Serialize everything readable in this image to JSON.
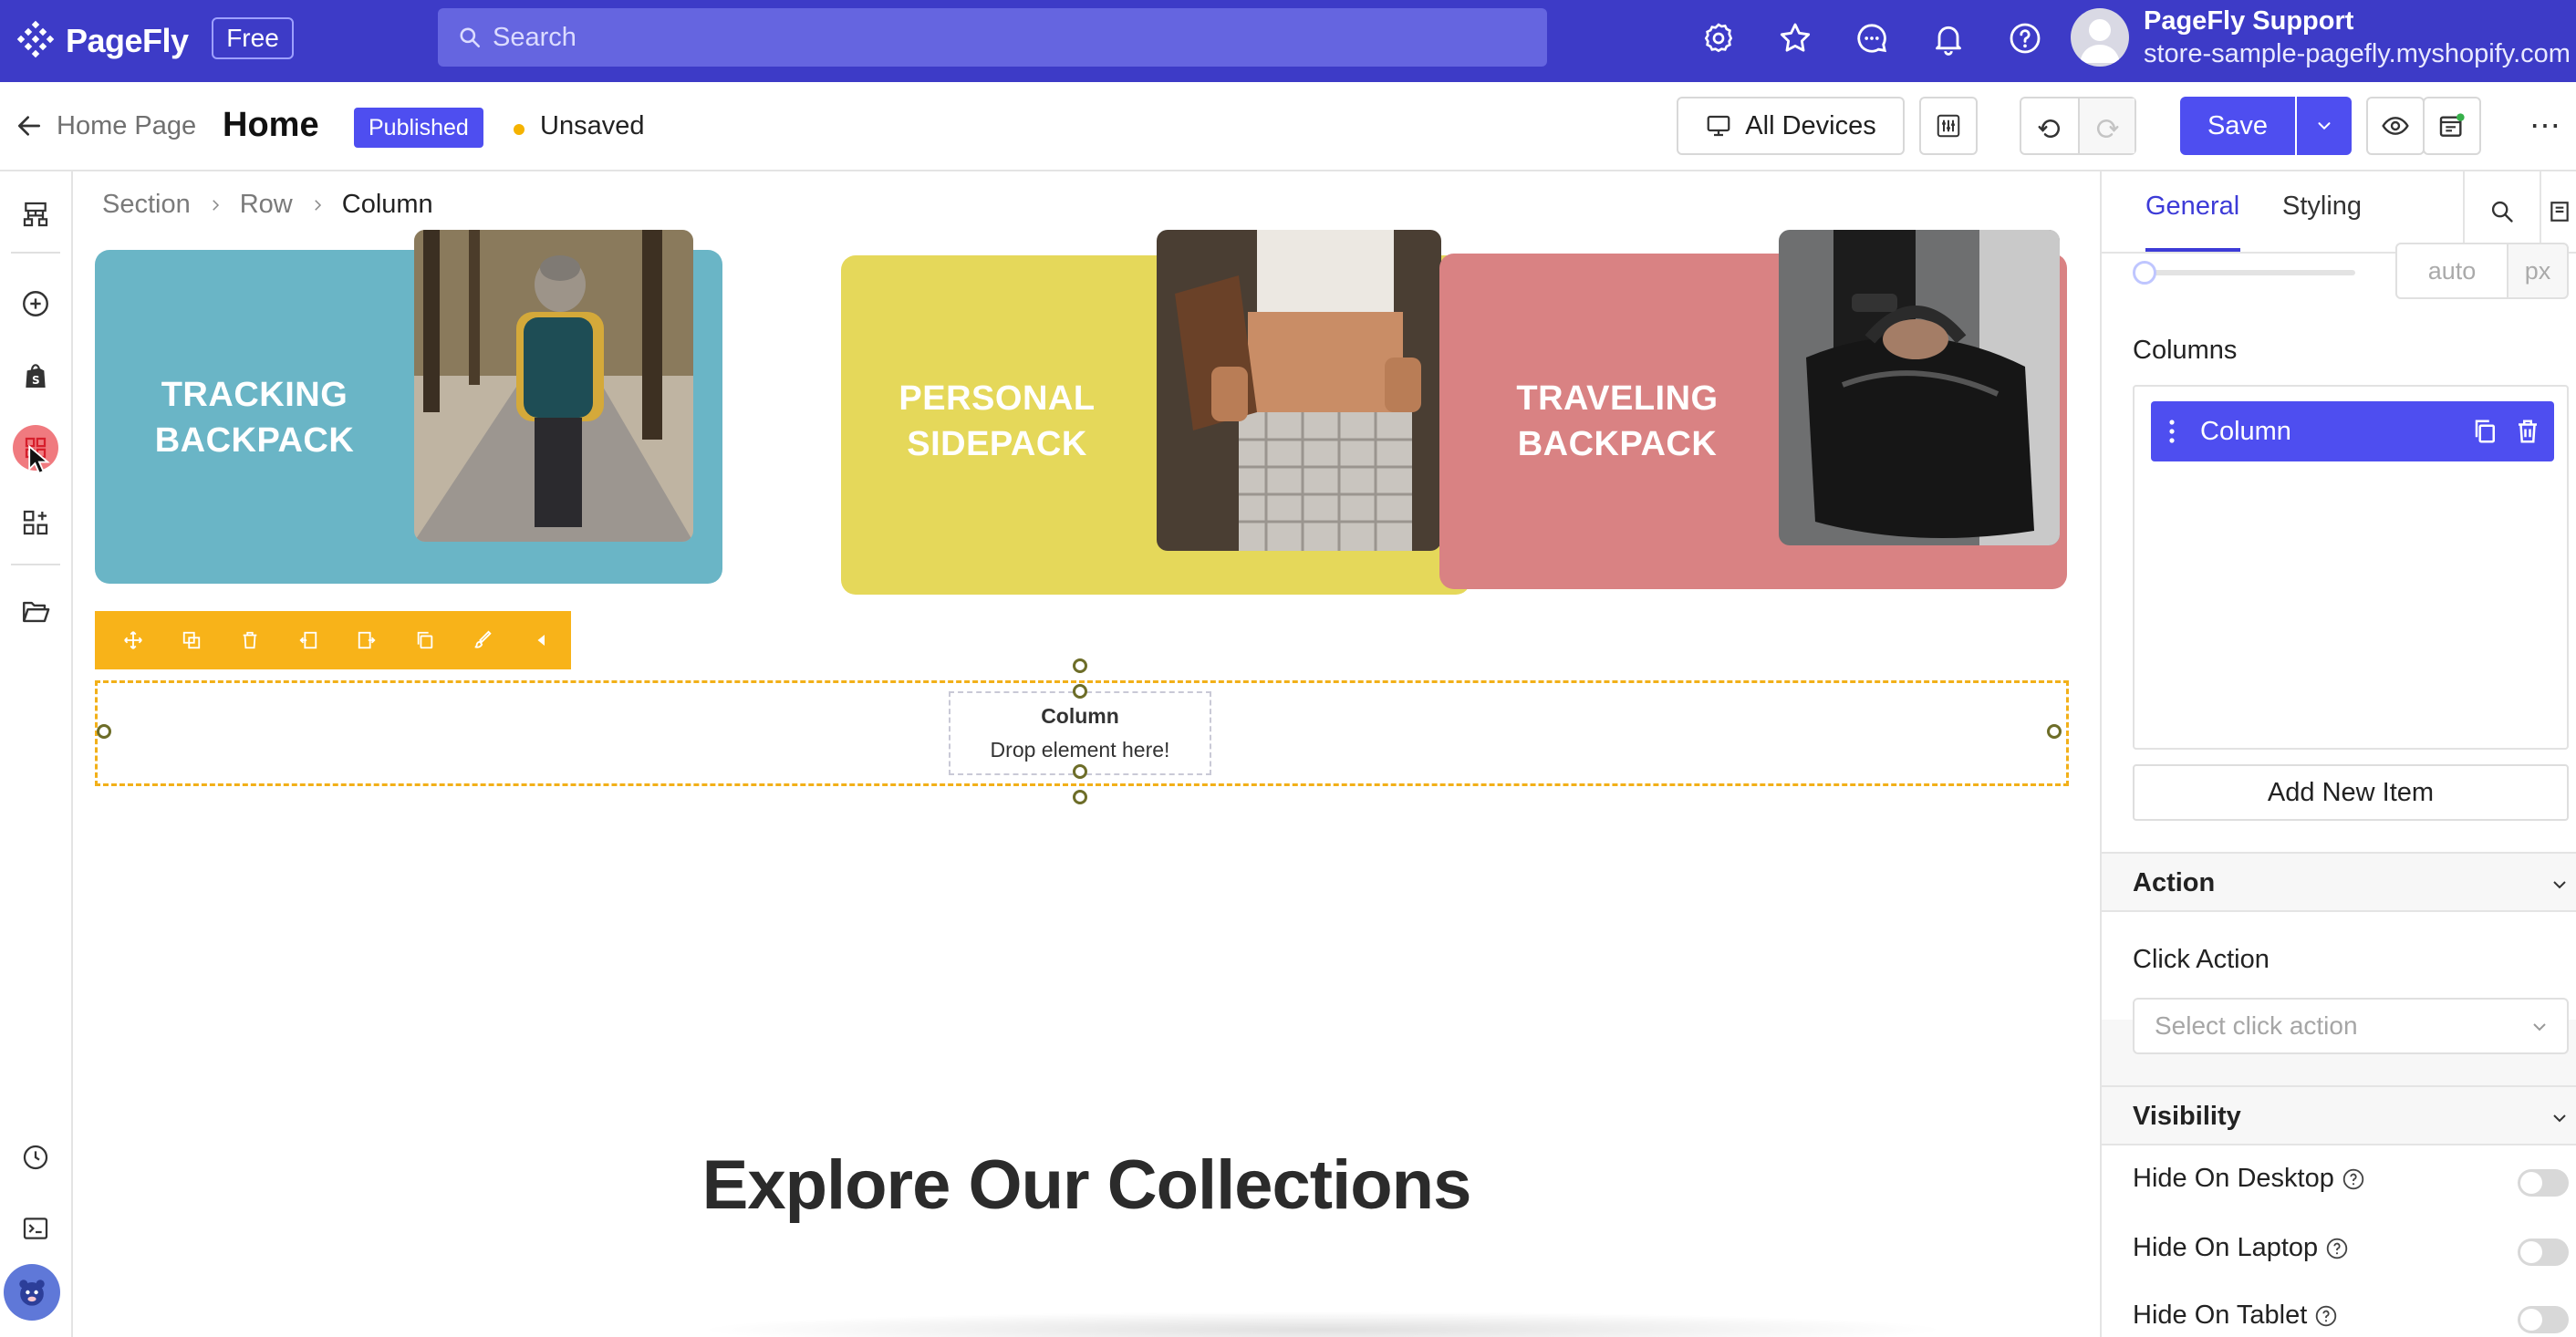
{
  "topbar": {
    "brand": "PageFly",
    "plan_badge": "Free",
    "search_placeholder": "Search",
    "account_name": "PageFly Support",
    "account_store": "store-sample-pagefly.myshopify.com"
  },
  "header": {
    "back_label": "Home Page",
    "page_title": "Home",
    "status_badge": "Published",
    "save_state": "Unsaved",
    "devices_label": "All Devices",
    "save_label": "Save",
    "more_label": "⋯"
  },
  "canvas": {
    "breadcrumb": [
      "Section",
      "Row",
      "Column"
    ],
    "cards": [
      {
        "line1": "TRACKING",
        "line2": "BACKPACK",
        "color": "#6ab5c6"
      },
      {
        "line1": "PERSONAL",
        "line2": "SIDEPACK",
        "color": "#e5d85a"
      },
      {
        "line1": "TRAVELING",
        "line2": "BACKPACK",
        "color": "#d98283"
      }
    ],
    "column_placeholder_title": "Column",
    "column_placeholder_hint": "Drop element here!",
    "section_heading": "Explore Our Collections"
  },
  "panel": {
    "tabs": [
      "General",
      "Styling"
    ],
    "active_tab": "General",
    "width_value": "auto",
    "width_unit": "px",
    "columns_label": "Columns",
    "column_item_label": "Column",
    "add_item_label": "Add New Item",
    "action_section": "Action",
    "click_action_label": "Click Action",
    "click_action_placeholder": "Select click action",
    "visibility_section": "Visibility",
    "visibility_items": [
      {
        "label": "Hide On Desktop",
        "on": false
      },
      {
        "label": "Hide On Laptop",
        "on": false
      },
      {
        "label": "Hide On Tablet",
        "on": false
      }
    ]
  },
  "colors": {
    "brand": "#3d3bc7",
    "accent": "#4e4ef0",
    "selection": "#f8b319"
  }
}
